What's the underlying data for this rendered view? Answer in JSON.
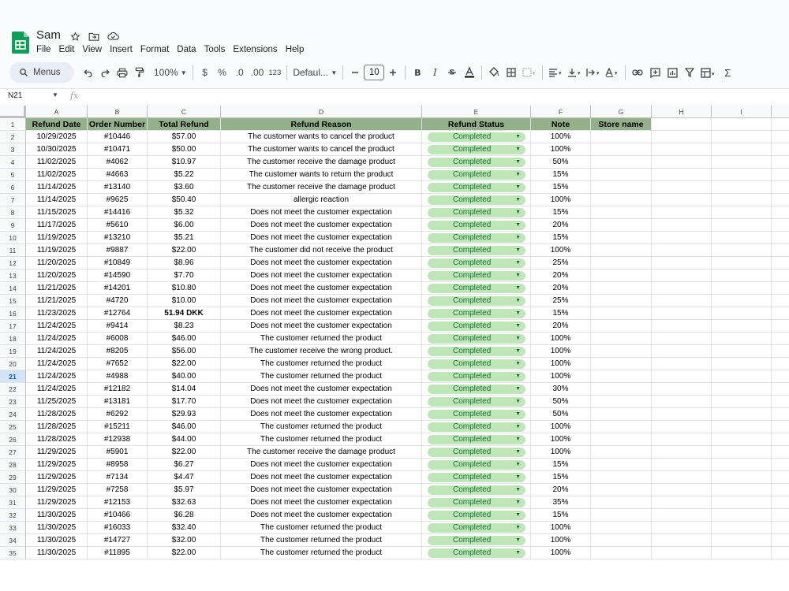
{
  "document": {
    "title": "Sam",
    "menu": [
      "File",
      "Edit",
      "View",
      "Insert",
      "Format",
      "Data",
      "Tools",
      "Extensions",
      "Help"
    ]
  },
  "toolbar": {
    "search_label": "Menus",
    "zoom": "100%",
    "currency": "$",
    "percent": "%",
    "decrease_decimal": ".0",
    "increase_decimal": ".00",
    "number_format": "123",
    "font": "Defaul...",
    "font_size": "10",
    "bold": "B",
    "italic": "I"
  },
  "formula_bar": {
    "name_box": "N21",
    "fx": "fx"
  },
  "columns": [
    "A",
    "B",
    "C",
    "D",
    "E",
    "F",
    "G",
    "H",
    "I"
  ],
  "selected_row": 21,
  "header_row": {
    "refund_date": "Refund Date",
    "order_number": "Order Number",
    "total_refund": "Total Refund",
    "refund_reason": "Refund Reason",
    "refund_status": "Refund Status",
    "note": "Note",
    "store_name": "Store name"
  },
  "rows": [
    {
      "n": "2",
      "date": "10/29/2025",
      "order": "#10446",
      "total": "$57.00",
      "reason": "The customer wants to cancel the product",
      "status": "Completed",
      "note": "100%"
    },
    {
      "n": "3",
      "date": "10/30/2025",
      "order": "#10471",
      "total": "$50.00",
      "reason": "The customer wants to cancel the product",
      "status": "Completed",
      "note": "100%"
    },
    {
      "n": "4",
      "date": "11/02/2025",
      "order": "#4062",
      "total": "$10.97",
      "reason": "The customer receive the damage product",
      "status": "Completed",
      "note": "50%"
    },
    {
      "n": "5",
      "date": "11/02/2025",
      "order": "#4663",
      "total": "$5.22",
      "reason": "The customer wants to return the product",
      "status": "Completed",
      "note": "15%"
    },
    {
      "n": "6",
      "date": "11/14/2025",
      "order": "#13140",
      "total": "$3.60",
      "reason": "The customer receive the damage product",
      "status": "Completed",
      "note": "15%"
    },
    {
      "n": "7",
      "date": "11/14/2025",
      "order": "#9625",
      "total": "$50.40",
      "reason": "allergic reaction",
      "status": "Completed",
      "note": "100%"
    },
    {
      "n": "8",
      "date": "11/15/2025",
      "order": "#14416",
      "total": "$5.32",
      "reason": "Does not meet the customer expectation",
      "status": "Completed",
      "note": "15%"
    },
    {
      "n": "9",
      "date": "11/17/2025",
      "order": "#5610",
      "total": "$6.00",
      "reason": "Does not meet the customer expectation",
      "status": "Completed",
      "note": "20%"
    },
    {
      "n": "10",
      "date": "11/19/2025",
      "order": "#13210",
      "total": "$5.21",
      "reason": "Does not meet the customer expectation",
      "status": "Completed",
      "note": "15%"
    },
    {
      "n": "11",
      "date": "11/19/2025",
      "order": "#9887",
      "total": "$22.00",
      "reason": "The customer did not receive the product",
      "status": "Completed",
      "note": "100%"
    },
    {
      "n": "12",
      "date": "11/20/2025",
      "order": "#10849",
      "total": "$8.96",
      "reason": "Does not meet the customer expectation",
      "status": "Completed",
      "note": "25%"
    },
    {
      "n": "13",
      "date": "11/20/2025",
      "order": "#14590",
      "total": "$7.70",
      "reason": "Does not meet the customer expectation",
      "status": "Completed",
      "note": "20%"
    },
    {
      "n": "14",
      "date": "11/21/2025",
      "order": "#14201",
      "total": "$10.80",
      "reason": "Does not meet the customer expectation",
      "status": "Completed",
      "note": "20%"
    },
    {
      "n": "15",
      "date": "11/21/2025",
      "order": "#4720",
      "total": "$10.00",
      "reason": "Does not meet the customer expectation",
      "status": "Completed",
      "note": "25%"
    },
    {
      "n": "16",
      "date": "11/23/2025",
      "order": "#12764",
      "total": "51.94 DKK",
      "reason": "Does not meet the customer expectation",
      "status": "Completed",
      "note": "15%",
      "bold_total": true
    },
    {
      "n": "17",
      "date": "11/24/2025",
      "order": "#9414",
      "total": "$8.23",
      "reason": "Does not meet the customer expectation",
      "status": "Completed",
      "note": "20%"
    },
    {
      "n": "18",
      "date": "11/24/2025",
      "order": "#6008",
      "total": "$46.00",
      "reason": "The customer returned the product",
      "status": "Completed",
      "note": "100%"
    },
    {
      "n": "19",
      "date": "11/24/2025",
      "order": "#8205",
      "total": "$56.00",
      "reason": "The customer receive the wrong product.",
      "status": "Completed",
      "note": "100%"
    },
    {
      "n": "20",
      "date": "11/24/2025",
      "order": "#7652",
      "total": "$22.00",
      "reason": "The customer returned the product",
      "status": "Completed",
      "note": "100%"
    },
    {
      "n": "21",
      "date": "11/24/2025",
      "order": "#4988",
      "total": "$40.00",
      "reason": "The customer returned the product",
      "status": "Completed",
      "note": "100%"
    },
    {
      "n": "22",
      "date": "11/24/2025",
      "order": "#12182",
      "total": "$14.04",
      "reason": "Does not meet the customer expectation",
      "status": "Completed",
      "note": "30%"
    },
    {
      "n": "23",
      "date": "11/25/2025",
      "order": "#13181",
      "total": "$17.70",
      "reason": "Does not meet the customer expectation",
      "status": "Completed",
      "note": "50%"
    },
    {
      "n": "24",
      "date": "11/28/2025",
      "order": "#6292",
      "total": "$29.93",
      "reason": "Does not meet the customer expectation",
      "status": "Completed",
      "note": "50%"
    },
    {
      "n": "25",
      "date": "11/28/2025",
      "order": "#15211",
      "total": "$46.00",
      "reason": "The customer returned the product",
      "status": "Completed",
      "note": "100%"
    },
    {
      "n": "26",
      "date": "11/28/2025",
      "order": "#12938",
      "total": "$44.00",
      "reason": "The customer returned the product",
      "status": "Completed",
      "note": "100%"
    },
    {
      "n": "27",
      "date": "11/29/2025",
      "order": "#5901",
      "total": "$22.00",
      "reason": "The customer receive the damage product",
      "status": "Completed",
      "note": "100%"
    },
    {
      "n": "28",
      "date": "11/29/2025",
      "order": "#8958",
      "total": "$6.27",
      "reason": "Does not meet the customer expectation",
      "status": "Completed",
      "note": "15%"
    },
    {
      "n": "29",
      "date": "11/29/2025",
      "order": "#7134",
      "total": "$4.47",
      "reason": "Does not meet the customer expectation",
      "status": "Completed",
      "note": "15%"
    },
    {
      "n": "30",
      "date": "11/29/2025",
      "order": "#7258",
      "total": "$5.97",
      "reason": "Does not meet the customer expectation",
      "status": "Completed",
      "note": "20%"
    },
    {
      "n": "31",
      "date": "11/29/2025",
      "order": "#12153",
      "total": "$32.63",
      "reason": "Does not meet the customer expectation",
      "status": "Completed",
      "note": "35%"
    },
    {
      "n": "32",
      "date": "11/30/2025",
      "order": "#10466",
      "total": "$6.28",
      "reason": "Does not meet the customer expectation",
      "status": "Completed",
      "note": "15%"
    },
    {
      "n": "33",
      "date": "11/30/2025",
      "order": "#16033",
      "total": "$32.40",
      "reason": "The customer returned the product",
      "status": "Completed",
      "note": "100%"
    },
    {
      "n": "34",
      "date": "11/30/2025",
      "order": "#14727",
      "total": "$32.00",
      "reason": "The customer returned the product",
      "status": "Completed",
      "note": "100%"
    },
    {
      "n": "35",
      "date": "11/30/2025",
      "order": "#11895",
      "total": "$22.00",
      "reason": "The customer returned the product",
      "status": "Completed",
      "note": "100%"
    }
  ],
  "colors": {
    "header_green": "#93b08a",
    "chip_green": "#bfe6b9",
    "chip_text": "#137333",
    "sheets_green": "#0f9d58"
  }
}
